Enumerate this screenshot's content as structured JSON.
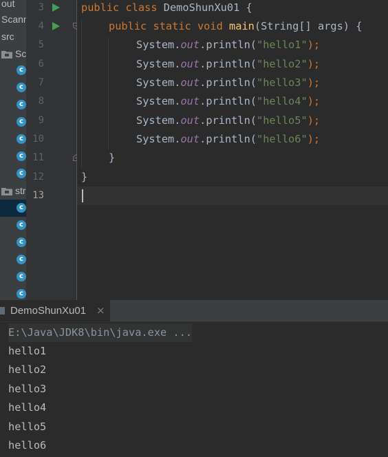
{
  "project_tree": {
    "item_out": "out",
    "item_scanner": "Scanner",
    "item_src": "src",
    "item_package_1": "Sc",
    "item_package_2": "str",
    "class_icon_glyph": "c"
  },
  "gutter": {
    "line_numbers": [
      "3",
      "4",
      "5",
      "6",
      "7",
      "8",
      "9",
      "10",
      "11",
      "12",
      "13"
    ]
  },
  "code": {
    "line3": {
      "kw1": "public",
      "kw2": "class",
      "name": "DemoShunXu01",
      "brace": "{"
    },
    "line4": {
      "kw1": "public",
      "kw2": "static",
      "kw3": "void",
      "method": "main",
      "params": "(String[] args) {"
    },
    "statements": [
      {
        "obj": "System.",
        "field": "out",
        "call": ".println(",
        "arg": "\"hello1\"",
        "end": ");"
      },
      {
        "obj": "System.",
        "field": "out",
        "call": ".println(",
        "arg": "\"hello2\"",
        "end": ");"
      },
      {
        "obj": "System.",
        "field": "out",
        "call": ".println(",
        "arg": "\"hello3\"",
        "end": ");"
      },
      {
        "obj": "System.",
        "field": "out",
        "call": ".println(",
        "arg": "\"hello4\"",
        "end": ");"
      },
      {
        "obj": "System.",
        "field": "out",
        "call": ".println(",
        "arg": "\"hello5\"",
        "end": ");"
      },
      {
        "obj": "System.",
        "field": "out",
        "call": ".println(",
        "arg": "\"hello6\"",
        "end": ");"
      }
    ],
    "line11": "}",
    "line12": "}"
  },
  "run_panel": {
    "tab_label": "DemoShunXu01",
    "tab_close": "×",
    "command": "E:\\Java\\JDK8\\bin\\java.exe ...",
    "output": [
      "hello1",
      "hello2",
      "hello3",
      "hello4",
      "hello5",
      "hello6"
    ]
  },
  "colors": {
    "keyword": "#cc7832",
    "method": "#ffc66d",
    "field": "#9876aa",
    "string": "#6a8759",
    "run_arrow": "#499c54",
    "class_icon": "#3592c4"
  },
  "icons": {
    "run_gutter": "run-arrow-icon",
    "fold": "fold-marker-icon",
    "package": "package-folder-icon",
    "class": "java-class-icon"
  }
}
